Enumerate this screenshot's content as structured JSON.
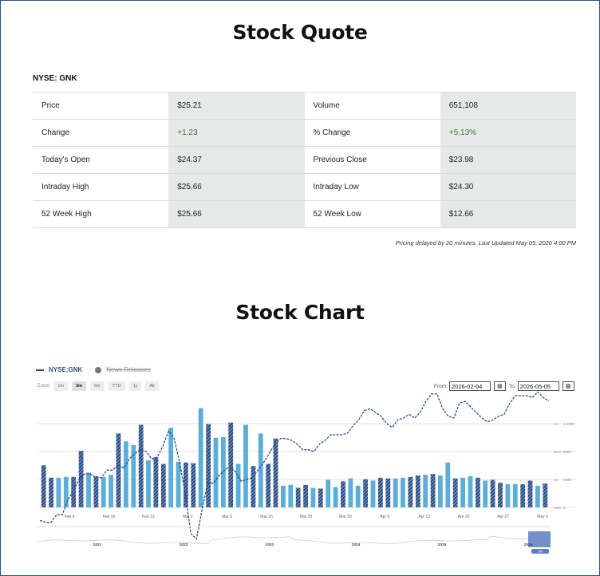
{
  "page": {
    "quote_title": "Stock Quote",
    "chart_title": "Stock Chart"
  },
  "quote": {
    "ticker_label": "NYSE: GNK",
    "rows": [
      {
        "l1": "Price",
        "v1": "$25.21",
        "l2": "Volume",
        "v2": "651,108"
      },
      {
        "l1": "Change",
        "v1": "+1.23",
        "l2": "% Change",
        "v2": "+5.13%"
      },
      {
        "l1": "Today's Open",
        "v1": "$24.37",
        "l2": "Previous Close",
        "v2": "$23.98"
      },
      {
        "l1": "Intraday High",
        "v1": "$25.66",
        "l2": "Intraday Low",
        "v2": "$24.30"
      },
      {
        "l1": "52 Week High",
        "v1": "$25.66",
        "l2": "52 Week Low",
        "v2": "$12.66"
      }
    ],
    "delay_note": "Pricing delayed by 20 minutes. Last Updated May 05, 2026 4:00 PM"
  },
  "chart": {
    "legend": {
      "series": "NYSE:GNK",
      "news": "News Releases"
    },
    "zoom_label": "Zoom",
    "zoom_options": [
      "1m",
      "3m",
      "6m",
      "YTD",
      "1y",
      "All"
    ],
    "zoom_active": "3m",
    "from_label": "From:",
    "from_value": "2026-02-04",
    "to_label": "To:",
    "to_value": "2026-05-05",
    "calendar_icon": "calendar-icon",
    "colors": {
      "line": "#2b4f8a",
      "bar_light": "#5aaed7",
      "bar_dark": "#2b4f8a",
      "grid": "#e3e3e3",
      "navigator_handle": "#5b7fc1"
    }
  },
  "chart_data": {
    "type": "line",
    "series": [
      {
        "name": "NYSE:GNK",
        "type": "line",
        "values": [
          18.8,
          18.7,
          18.7,
          19.1,
          19.1,
          19.9,
          20.4,
          21.0,
          21.3,
          21.3,
          21.1,
          21.1,
          21.5,
          21.5,
          21.8,
          21.6,
          22.1,
          22.4,
          22.6,
          22.5,
          22.1,
          22.2,
          22.8,
          23.6,
          23.2,
          21.9,
          20.2,
          18.1,
          17.8,
          19.4,
          20.8,
          20.8,
          21.2,
          21.5,
          21.7,
          21.4,
          20.9,
          21.0,
          21.1,
          21.5,
          21.9,
          22.4,
          22.9,
          23.2,
          23.2,
          23.1,
          22.9,
          22.6,
          22.6,
          22.5,
          22.9,
          23.1,
          23.4,
          23.4,
          23.4,
          23.5,
          23.9,
          24.2,
          24.7,
          24.8,
          24.6,
          24.4,
          24.0,
          23.8,
          24.2,
          24.3,
          24.5,
          24.3,
          24.6,
          25.2,
          25.6,
          25.6,
          24.8,
          24.4,
          24.3,
          25.1,
          25.2,
          24.9,
          24.6,
          24.3,
          24.1,
          24.2,
          24.4,
          24.5,
          25.1,
          25.5,
          25.5,
          25.5,
          25.4,
          25.7,
          25.4,
          25.2
        ]
      },
      {
        "name": "Volume",
        "type": "bar",
        "values": [
          580000,
          410000,
          410000,
          420000,
          420000,
          780000,
          480000,
          430000,
          420000,
          450000,
          1020000,
          910000,
          860000,
          1140000,
          650000,
          690000,
          600000,
          1100000,
          630000,
          620000,
          610000,
          1370000,
          1150000,
          960000,
          970000,
          1170000,
          600000,
          1140000,
          570000,
          1020000,
          600000,
          950000,
          300000,
          310000,
          270000,
          310000,
          270000,
          260000,
          380000,
          280000,
          360000,
          400000,
          300000,
          390000,
          370000,
          410000,
          400000,
          400000,
          410000,
          420000,
          440000,
          450000,
          460000,
          440000,
          620000,
          400000,
          410000,
          430000,
          410000,
          370000,
          380000,
          340000,
          320000,
          320000,
          320000,
          370000,
          300000,
          330000
        ]
      }
    ],
    "x_ticks": [
      "Feb 9",
      "Feb 16",
      "Feb 23",
      "Mar 2",
      "Mar 9",
      "Mar 16",
      "Mar 23",
      "Mar 30",
      "Apr 6",
      "Apr 13",
      "Apr 20",
      "Apr 27",
      "May 4"
    ],
    "y_price_ticks": [
      "24",
      "22.5",
      "21",
      "19.5"
    ],
    "y_volume_ticks": [
      "1,200k",
      "800k",
      "400k",
      "0"
    ],
    "ylim_price": [
      19.5,
      24
    ],
    "ylim_volume": [
      0,
      1200000
    ],
    "navigator_years": [
      "2021",
      "2022",
      "2023",
      "2024",
      "2025",
      "2026"
    ],
    "navigator_badge": "3M",
    "grid": true,
    "legend_position": "top-left"
  }
}
